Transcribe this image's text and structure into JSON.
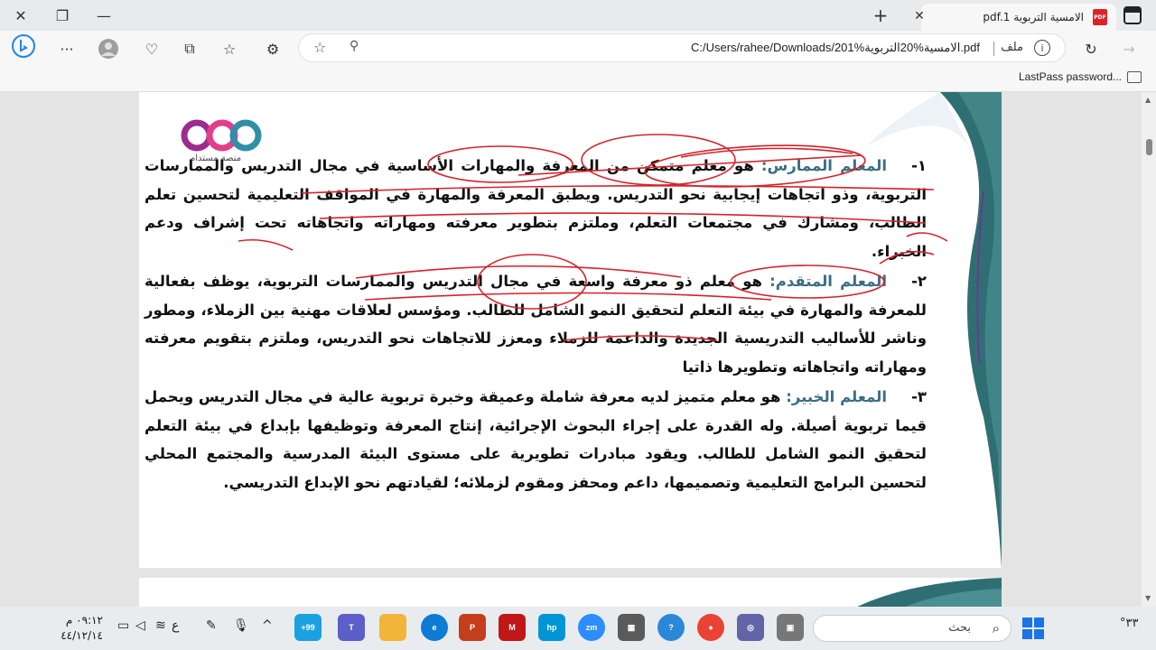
{
  "window": {
    "tab_title": "الامسية التربوية pdf.1",
    "pdf_badge": "PDF"
  },
  "toolbar": {
    "url": "C:/Users/rahee/Downloads/الامسية%20التربوية%201.pdf",
    "file_label": "ملف",
    "info_icon": "i"
  },
  "favorites": {
    "items": [
      "LastPass password..."
    ]
  },
  "logo": {
    "text": "منصة مستدام"
  },
  "document": {
    "items": [
      {
        "num": "١-",
        "term": "المعلم الممارس:",
        "body": " هو معلم متمكن من المعرفة والمهارات الأساسية في مجال التدريس والممارسات التربوية، وذو اتجاهات إيجابية نحو التدريس. ويطبق المعرفة والمهارة في المواقف التعليمية لتحسين تعلم الطالب، ومشارك في مجتمعات التعلم، وملتزم بتطوير معرفته ومهاراته واتجاهاته تحت إشراف ودعم الخبراء."
      },
      {
        "num": "٢-",
        "term": "المعلم المتقدم:",
        "body": " هو معلم ذو معرفة واسعة في مجال التدريس والممارسات التربوية، يوظف بفعالية للمعرفة والمهارة في بيئة التعلم لتحقيق النمو الشامل للطالب. ومؤسس لعلاقات مهنية بين الزملاء، ومطور وناشر للأساليب التدريسية الجديدة والداعمة للزملاء ومعزز للاتجاهات نحو التدريس، وملتزم بتقويم معرفته ومهاراته واتجاهاته وتطويرها ذاتيا"
      },
      {
        "num": "٣-",
        "term": "المعلم الخبير:",
        "body": " هو معلم متميز لديه معرفة شاملة وعميقة وخبرة تربوية عالية في مجال التدريس ويحمل قيما تربوية أصيلة. وله القدرة على إجراء البحوث الإجرائية، إنتاج المعرفة وتوظيفها بإبداع في بيئة التعلم لتحقيق النمو الشامل للطالب. ويقود مبادرات تطويرية على مستوى البيئة المدرسية والمجتمع المحلي لتحسين البرامج التعليمية وتصميمها، داعم ومحفز ومقوم لزملائه؛ لقيادتهم نحو الإبداع التدريسي."
      }
    ]
  },
  "taskbar": {
    "search_placeholder": "بحث",
    "time": "٠٩:١٢ م",
    "date": "٤٤/١٢/١٤",
    "lang": "ع",
    "weather": "٣٣°",
    "badge": "+99",
    "apps": [
      "mail",
      "teams",
      "explorer",
      "edge",
      "powerpoint",
      "mcafee",
      "myhp",
      "zoom",
      "store",
      "tips",
      "chrome",
      "chat",
      "notes"
    ]
  },
  "colors": {
    "accent_term": "#3a6e83",
    "ink_red": "#d4232a",
    "deco_teal": "#2f6f73"
  }
}
